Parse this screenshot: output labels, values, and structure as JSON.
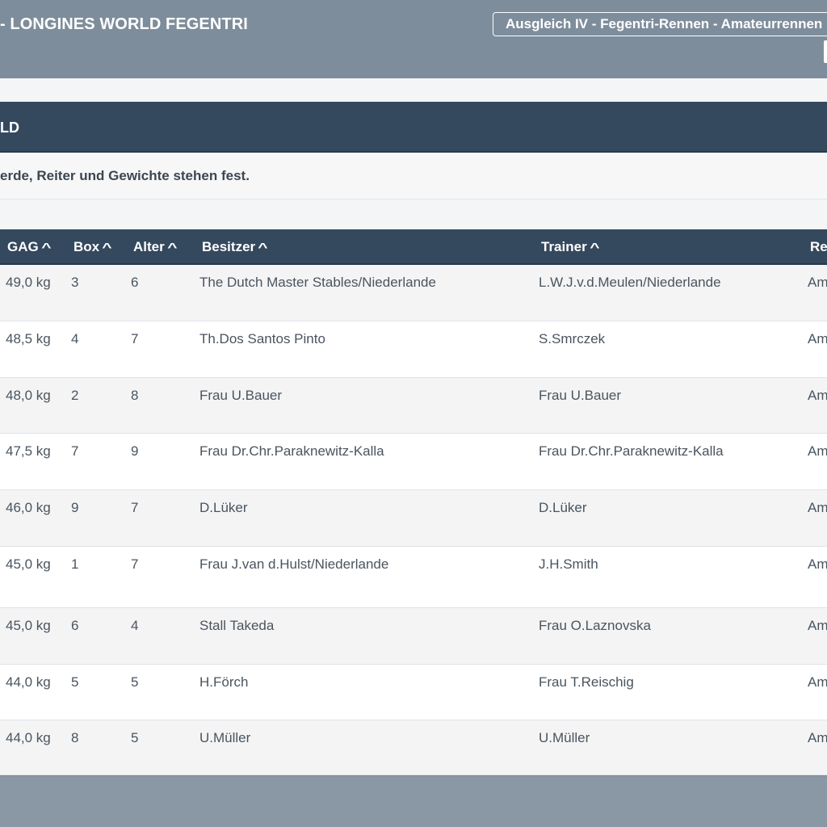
{
  "header": {
    "title": "- LONGINES WORLD FEGENTRI",
    "race_select": "Ausgleich IV - Fegentri-Rennen - Amateurrennen"
  },
  "section": {
    "title": "LD",
    "notice": "erde, Reiter und Gewichte stehen fest."
  },
  "table": {
    "columns": [
      {
        "label": "GAG",
        "sortable": true
      },
      {
        "label": "Box",
        "sortable": true
      },
      {
        "label": "Alter",
        "sortable": true
      },
      {
        "label": "Besitzer",
        "sortable": true
      },
      {
        "label": "Trainer",
        "sortable": true
      },
      {
        "label": "Re",
        "sortable": false
      }
    ],
    "sort_icon": "chevron-up-icon",
    "rows": [
      {
        "gag": "49,0 kg",
        "box": "3",
        "alter": "6",
        "besitzer": "The Dutch Master Stables/Niederlande",
        "trainer": "L.W.J.v.d.Meulen/Niederlande",
        "re": "Am"
      },
      {
        "gag": "48,5 kg",
        "box": "4",
        "alter": "7",
        "besitzer": "Th.Dos Santos Pinto",
        "trainer": "S.Smrczek",
        "re": "Am"
      },
      {
        "gag": "48,0 kg",
        "box": "2",
        "alter": "8",
        "besitzer": "Frau U.Bauer",
        "trainer": "Frau U.Bauer",
        "re": "Am"
      },
      {
        "gag": "47,5 kg",
        "box": "7",
        "alter": "9",
        "besitzer": "Frau Dr.Chr.Paraknewitz-Kalla",
        "trainer": "Frau Dr.Chr.Paraknewitz-Kalla",
        "re": "Am"
      },
      {
        "gag": "46,0 kg",
        "box": "9",
        "alter": "7",
        "besitzer": "D.Lüker",
        "trainer": "D.Lüker",
        "re": "Am"
      },
      {
        "gag": "45,0 kg",
        "box": "1",
        "alter": "7",
        "besitzer": "Frau J.van d.Hulst/Niederlande",
        "trainer": "J.H.Smith",
        "re": "Am"
      },
      {
        "gag": "45,0 kg",
        "box": "6",
        "alter": "4",
        "besitzer": "Stall Takeda",
        "trainer": "Frau O.Laznovska",
        "re": "Am"
      },
      {
        "gag": "44,0 kg",
        "box": "5",
        "alter": "5",
        "besitzer": "H.Förch",
        "trainer": "Frau T.Reischig",
        "re": "Am"
      },
      {
        "gag": "44,0 kg",
        "box": "8",
        "alter": "5",
        "besitzer": "U.Müller",
        "trainer": "U.Müller",
        "re": "Am"
      }
    ]
  },
  "colors": {
    "top_bar": "#7e8d9b",
    "header_dark": "#34495e",
    "row_alt": "#f4f4f5",
    "row_text": "#4a545e"
  }
}
